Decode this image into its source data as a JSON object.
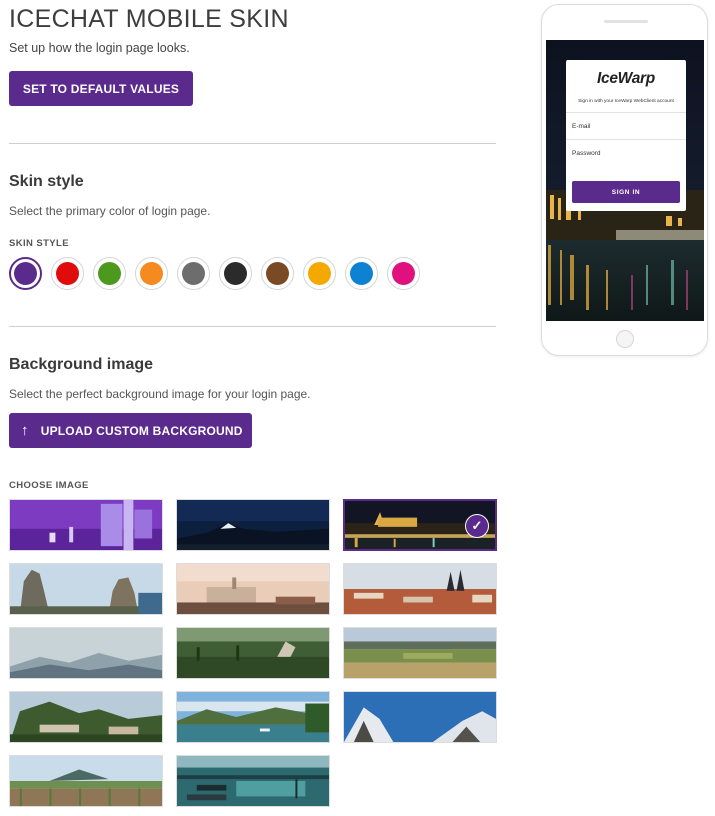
{
  "header": {
    "title": "ICECHAT MOBILE SKIN",
    "subtitle": "Set up how the login page looks.",
    "default_button": "SET TO DEFAULT VALUES"
  },
  "skin_style": {
    "title": "Skin style",
    "description": "Select the primary color of login page.",
    "label": "SKIN STYLE",
    "selected_index": 0,
    "colors": [
      {
        "name": "purple",
        "hex": "#5a2a8c"
      },
      {
        "name": "red",
        "hex": "#e00b0b"
      },
      {
        "name": "green",
        "hex": "#4b9a1d"
      },
      {
        "name": "orange",
        "hex": "#f58a1f"
      },
      {
        "name": "gray",
        "hex": "#6d6d6d"
      },
      {
        "name": "black",
        "hex": "#2b2b2b"
      },
      {
        "name": "brown",
        "hex": "#7a4a25"
      },
      {
        "name": "amber",
        "hex": "#f4a800"
      },
      {
        "name": "blue",
        "hex": "#0d82d2"
      },
      {
        "name": "pink",
        "hex": "#e0117f"
      }
    ]
  },
  "background": {
    "title": "Background image",
    "description": "Select the perfect background image for your login page.",
    "upload_button": "UPLOAD CUSTOM BACKGROUND",
    "choose_label": "CHOOSE IMAGE",
    "selected_index": 2,
    "images": [
      {
        "name": "purple-abstract"
      },
      {
        "name": "night-mountain"
      },
      {
        "name": "prague-castle-night"
      },
      {
        "name": "rock-formations"
      },
      {
        "name": "chateau-sunset"
      },
      {
        "name": "old-town-square"
      },
      {
        "name": "misty-hills"
      },
      {
        "name": "forest-valley"
      },
      {
        "name": "countryside-fields"
      },
      {
        "name": "rocky-town"
      },
      {
        "name": "mountain-lake"
      },
      {
        "name": "snowy-peaks"
      },
      {
        "name": "vineyard"
      },
      {
        "name": "harbor-boats"
      }
    ]
  },
  "phone_preview": {
    "logo": "IceWarp",
    "signin_text": "Sign in with your IceWarp WebClient account",
    "email_placeholder": "E-mail",
    "password_placeholder": "Password",
    "signin_button": "SIGN IN"
  },
  "accent": "#5a2a8c"
}
